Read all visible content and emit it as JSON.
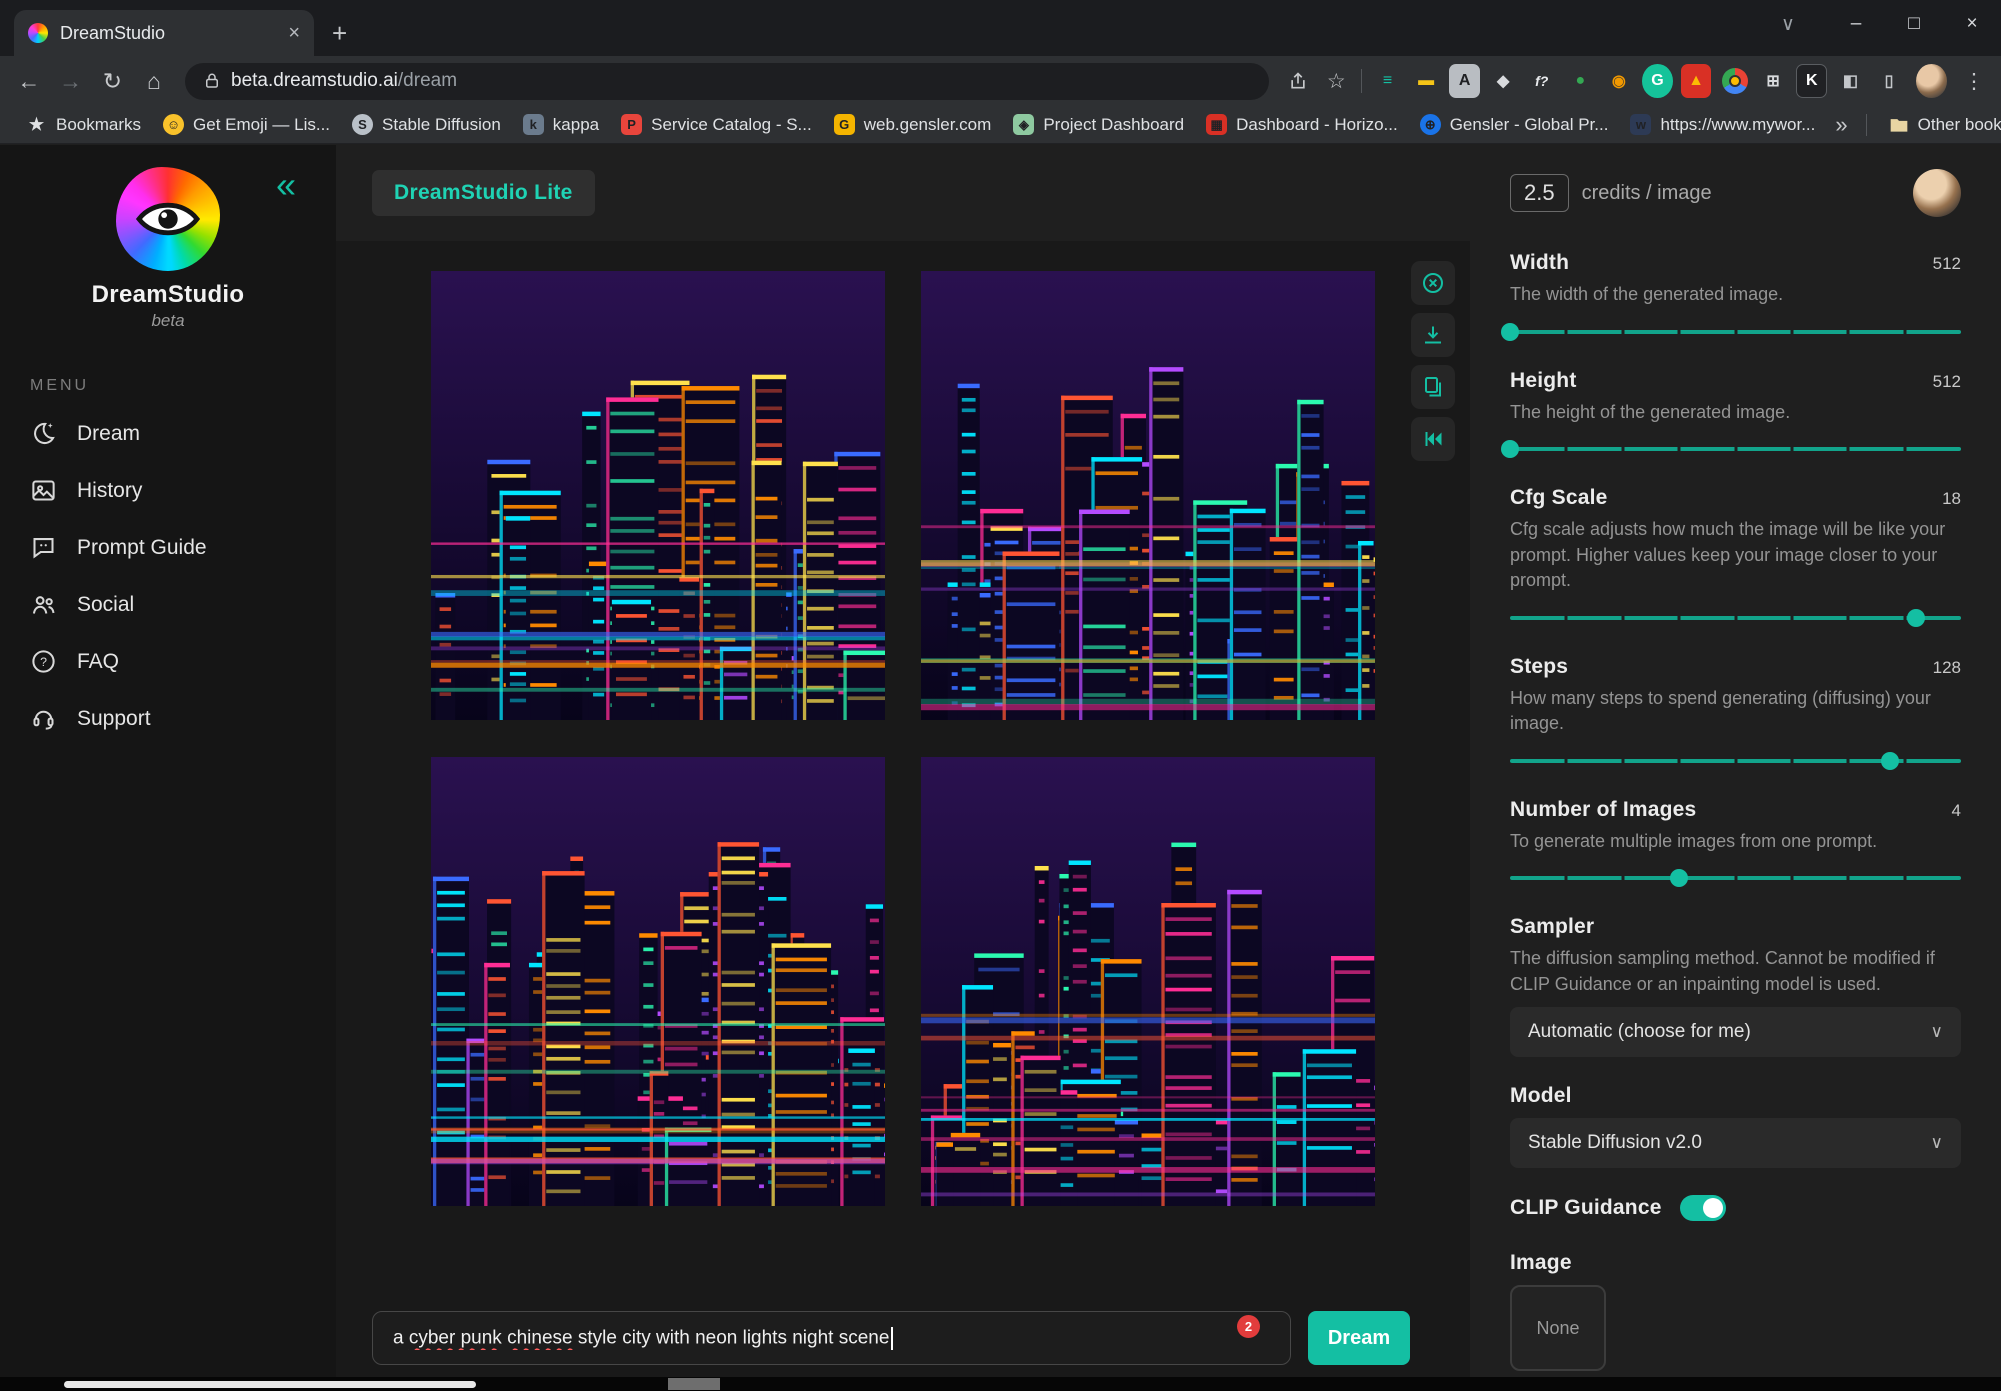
{
  "colors": {
    "accent": "#14bfa3",
    "badge_red": "#e23c3c",
    "misspell_red": "#ff5c5c",
    "neon_palette": [
      "#ff2d95",
      "#00e5ff",
      "#b44bff",
      "#ffe14d",
      "#ff5533",
      "#2bf9b0",
      "#ff8a00",
      "#3a6bff"
    ]
  },
  "browser": {
    "tab_title": "DreamStudio",
    "url_domain": "beta.dreamstudio.ai",
    "url_path": "/dream",
    "bookmarks_bar": {
      "items": [
        {
          "label": "Bookmarks",
          "glyph": "★",
          "color": ""
        },
        {
          "label": "Get Emoji — Lis...",
          "glyph": "☺",
          "color": "#f9c22b",
          "round": true
        },
        {
          "label": "Stable Diffusion",
          "glyph": "S",
          "color": "#b9c0c8",
          "round": true
        },
        {
          "label": "kappa",
          "glyph": "k",
          "color": "#6b7b8d"
        },
        {
          "label": "Service Catalog - S...",
          "glyph": "P",
          "color": "#e8453c"
        },
        {
          "label": "web.gensler.com",
          "glyph": "G",
          "color": "#f4b400"
        },
        {
          "label": "Project Dashboard",
          "glyph": "◈",
          "color": "#8ec9a0"
        },
        {
          "label": "Dashboard - Horizo...",
          "glyph": "▦",
          "color": "#d93025"
        },
        {
          "label": "Gensler - Global Pr...",
          "glyph": "⊕",
          "color": "#1a73e8",
          "round": true
        },
        {
          "label": "https://www.mywor...",
          "glyph": "w",
          "color": "#2d3a55"
        }
      ],
      "overflow_glyph": "»",
      "other_bookmarks_label": "Other bookmarks"
    }
  },
  "sidebar": {
    "brand": "DreamStudio",
    "brand_sub": "beta",
    "menu_label": "MENU",
    "items": [
      {
        "label": "Dream",
        "icon": "moon-sparkle-icon"
      },
      {
        "label": "History",
        "icon": "image-icon"
      },
      {
        "label": "Prompt Guide",
        "icon": "chat-bubble-icon"
      },
      {
        "label": "Social",
        "icon": "people-icon"
      },
      {
        "label": "FAQ",
        "icon": "question-circle-icon"
      },
      {
        "label": "Support",
        "icon": "headset-icon"
      }
    ]
  },
  "header": {
    "app_badge": "DreamStudio Lite",
    "credits_value": "2.5",
    "credits_label": "credits / image"
  },
  "canvas": {
    "generation_count": 4
  },
  "settings": {
    "width": {
      "label": "Width",
      "value": 512,
      "min": 512,
      "max": 1024,
      "desc": "The width of the generated image."
    },
    "height": {
      "label": "Height",
      "value": 512,
      "min": 512,
      "max": 1024,
      "desc": "The height of the generated image."
    },
    "cfg": {
      "label": "Cfg Scale",
      "value": 18,
      "min": 0,
      "max": 20,
      "desc": "Cfg scale adjusts how much the image will be like your prompt. Higher values keep your image closer to your prompt."
    },
    "steps": {
      "label": "Steps",
      "value": 128,
      "min": 10,
      "max": 150,
      "desc": "How many steps to spend generating (diffusing) your image."
    },
    "num_images": {
      "label": "Number of Images",
      "value": 4,
      "min": 1,
      "max": 9,
      "desc": "To generate multiple images from one prompt."
    },
    "sampler": {
      "label": "Sampler",
      "desc": "The diffusion sampling method. Cannot be modified if CLIP Guidance or an inpainting model is used.",
      "value": "Automatic (choose for me)"
    },
    "model": {
      "label": "Model",
      "value": "Stable Diffusion v2.0"
    },
    "clip": {
      "label": "CLIP Guidance",
      "on": true
    },
    "image": {
      "label": "Image",
      "value": "None"
    }
  },
  "prompt": {
    "full_text": "a cyber punk chinese style city with neon lights night scene",
    "segments": [
      {
        "text": "a ",
        "misspelled": false
      },
      {
        "text": "cyber punk",
        "misspelled": true
      },
      {
        "text": " ",
        "misspelled": false
      },
      {
        "text": "chinese",
        "misspelled": true
      },
      {
        "text": " style city with neon lights night scene",
        "misspelled": false
      }
    ],
    "badge": "2",
    "dream_button": "Dream"
  }
}
